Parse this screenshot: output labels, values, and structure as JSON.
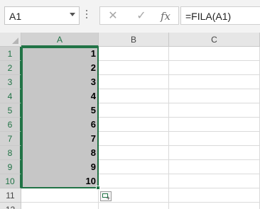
{
  "name_box": {
    "value": "A1"
  },
  "formula_bar": {
    "cancel_icon": "cancel-x-icon",
    "enter_icon": "check-icon",
    "fx_label": "fx",
    "formula": "=FILA(A1)"
  },
  "columns": [
    "A",
    "B",
    "C"
  ],
  "rows": [
    {
      "num": "1",
      "a": "1"
    },
    {
      "num": "2",
      "a": "2"
    },
    {
      "num": "3",
      "a": "3"
    },
    {
      "num": "4",
      "a": "4"
    },
    {
      "num": "5",
      "a": "5"
    },
    {
      "num": "6",
      "a": "6"
    },
    {
      "num": "7",
      "a": "7"
    },
    {
      "num": "8",
      "a": "8"
    },
    {
      "num": "9",
      "a": "9"
    },
    {
      "num": "10",
      "a": "10"
    },
    {
      "num": "11",
      "a": ""
    },
    {
      "num": "12",
      "a": ""
    }
  ],
  "selection": {
    "range": "A1:A10",
    "accent": "#217346",
    "fill": "#c6c6c6"
  },
  "quick_analysis": {
    "icon": "quick-analysis-icon"
  }
}
